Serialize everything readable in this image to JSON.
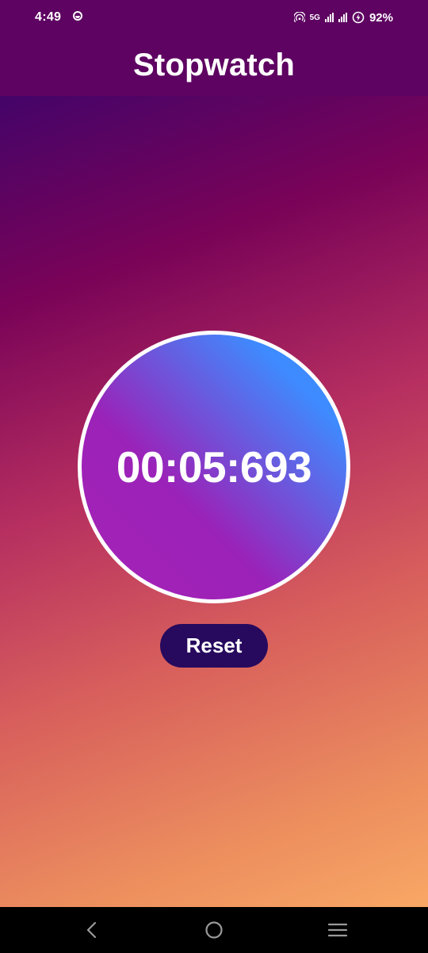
{
  "status_bar": {
    "time": "4:49",
    "network": "5G",
    "battery": "92%",
    "icons": [
      "notification-icon",
      "hotspot-icon",
      "signal-icon",
      "signal-icon",
      "battery-saver-icon"
    ]
  },
  "app_bar": {
    "title": "Stopwatch"
  },
  "stopwatch": {
    "time": "00:05:693"
  },
  "controls": {
    "reset_label": "Reset"
  },
  "nav_bar": {
    "icons": [
      "back-icon",
      "home-icon",
      "menu-icon"
    ]
  },
  "colors": {
    "app_bar": "#5e0362",
    "circle_start": "#3e8bff",
    "circle_end": "#a623b6",
    "button": "#270a5e",
    "background_top": "#2c0470",
    "background_bottom": "#fdb068"
  }
}
